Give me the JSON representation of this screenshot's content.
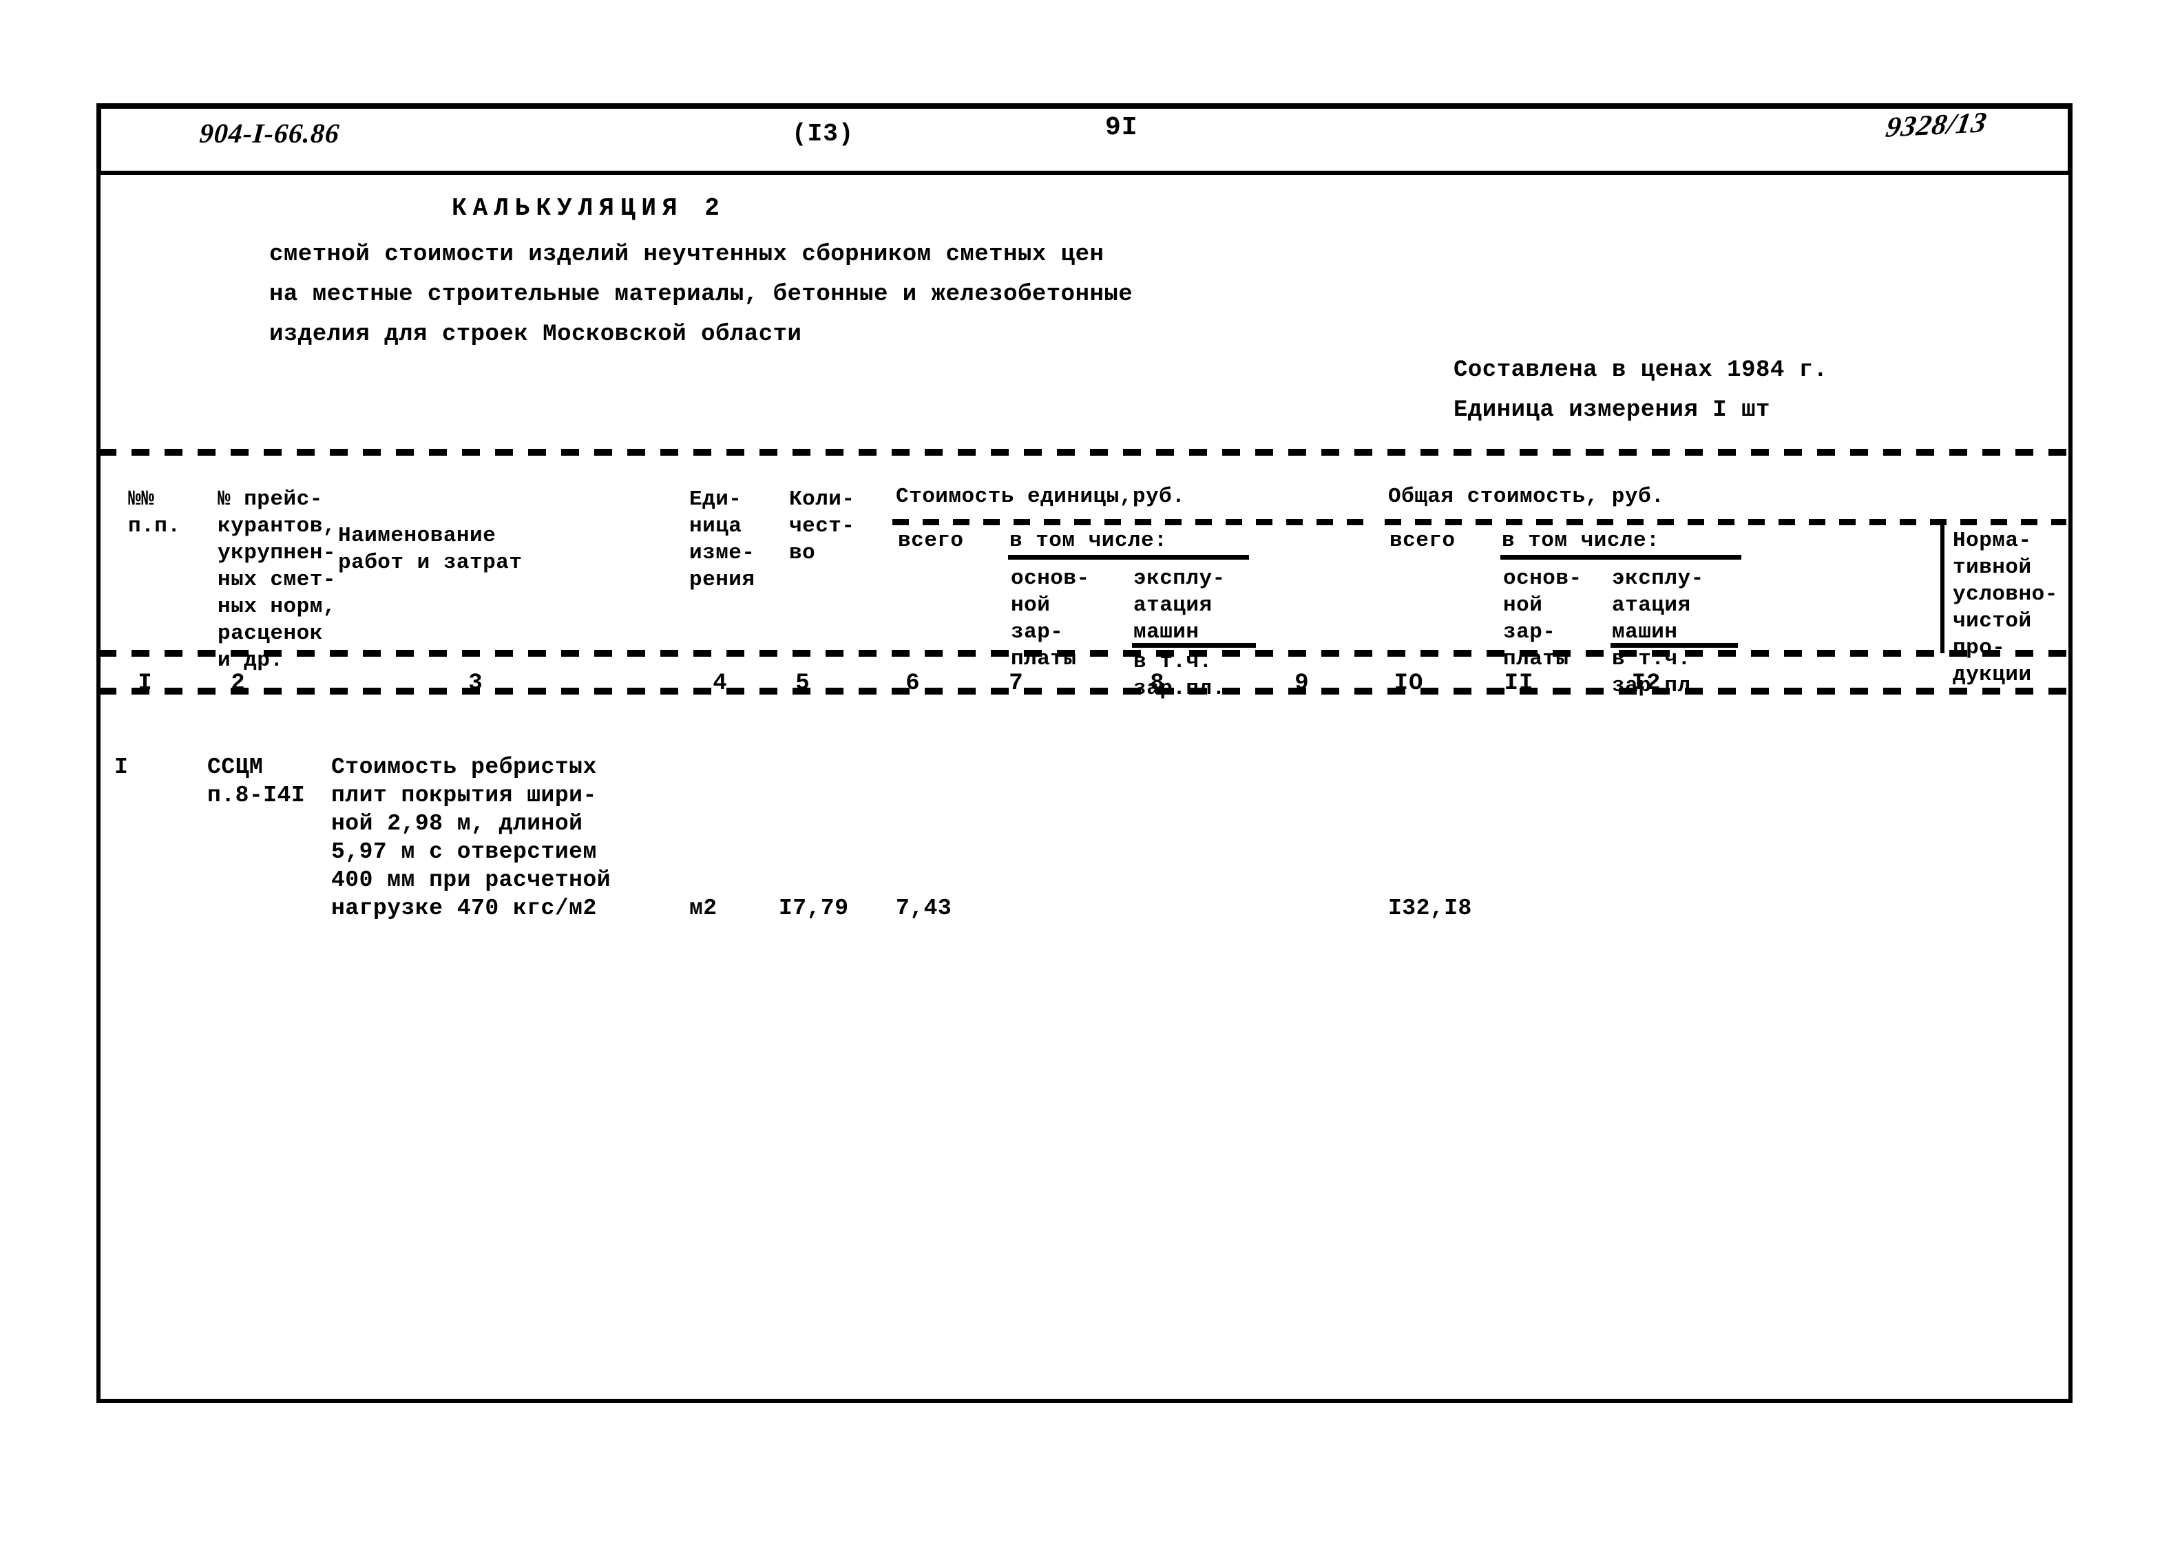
{
  "header": {
    "doc_code": "904-I-66.86",
    "sheet_index": "(I3)",
    "page_number": "9I",
    "archive_mark": "9328/13"
  },
  "title": {
    "main": "КАЛЬКУЛЯЦИЯ  2",
    "subtitle_1": "сметной стоимости изделий неучтенных сборником сметных цен",
    "subtitle_2": "на местные строительные материалы, бетонные и железобетонные",
    "subtitle_3": "изделия для строек Московской области",
    "note_prices": "Составлена в ценах 1984 г.",
    "note_unit": "Единица измерения  I шт"
  },
  "table": {
    "headers": {
      "c1": "№№\nп.п.",
      "c2": "№ прейс-\nкурантов,\nукрупнен-\nных смет-\nных норм,\nрасценок\nи др.",
      "c3": "Наименование\nработ и затрат",
      "c4": "Еди-\nница\nизме-\nрения",
      "c5": "Коли-\nчест-\nво",
      "group_unit_cost": "Стоимость единицы,руб.",
      "c6": "всего",
      "c7_8_label": "в том числе:",
      "c7": "основ-\nной\nзар-\nплаты",
      "c8": "эксплу-\nатация\nмашин",
      "c8_sub": "в т.ч.\nзар.пл.",
      "group_total_cost": "Общая стоимость, руб.",
      "c9": "всего",
      "c10_11_label": "в том числе:",
      "c10": "основ-\nной\nзар-\nплаты",
      "c11": "эксплу-\nатация\nмашин\nв т.ч.\nзар.пл.",
      "c12": "Норма-\nтивной\nусловно-\nчистой\nпро-\nдукции"
    },
    "column_numbers": [
      "I",
      "2",
      "3",
      "4",
      "5",
      "6",
      "7",
      "8",
      "9",
      "IO",
      "II",
      "I2"
    ],
    "rows": [
      {
        "c1": "I",
        "c2": "ССЦМ\nп.8-I4I",
        "c3": "Стоимость ребристых\nплит покрытия шири-\nной 2,98 м, длиной\n5,97 м с отверстием\n400 мм при расчетной\nнагрузке 470 кгс/м2",
        "c4": "м2",
        "c5": "I7,79",
        "c6": "7,43",
        "c7": "",
        "c8": "",
        "c9": "I32,I8",
        "c10": "",
        "c11": "",
        "c12": ""
      }
    ]
  }
}
